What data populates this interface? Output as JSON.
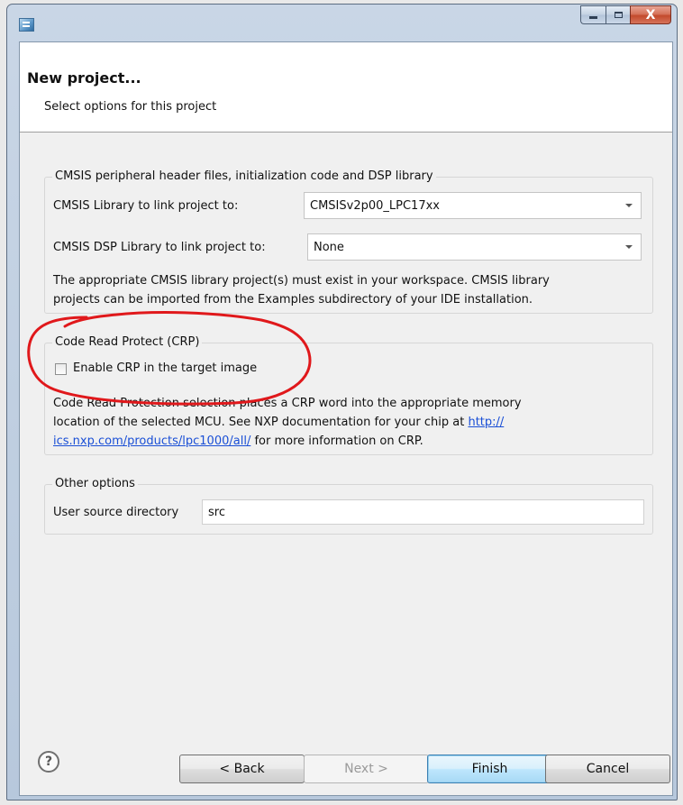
{
  "window": {
    "controls": {
      "minimize": "minimize",
      "maximize": "maximize",
      "close": "X"
    }
  },
  "header": {
    "title": "New project...",
    "subtitle": "Select options for this project"
  },
  "cmsis_group": {
    "legend": "CMSIS peripheral header files, initialization code and DSP library",
    "library_label": "CMSIS Library to link project to:",
    "library_value": "CMSISv2p00_LPC17xx",
    "dsp_label": "CMSIS DSP Library to link project to:",
    "dsp_value": "None",
    "note_line1": "The appropriate CMSIS library project(s) must exist in your workspace. CMSIS library",
    "note_line2": "projects can be imported from the Examples subdirectory of your IDE installation."
  },
  "crp_group": {
    "legend": "Code Read Protect (CRP)",
    "checkbox_label": "Enable CRP in the target image",
    "checkbox_checked": false,
    "desc_line1": "Code Read Protection selection places a CRP word into the appropriate memory",
    "desc_line2_text": "location of the selected MCU. See NXP documentation for your chip at ",
    "link_part1": "http://",
    "link_part2": "ics.nxp.com/products/lpc1000/all/",
    "desc_line3_text": " for more information on CRP."
  },
  "other_group": {
    "legend": "Other options",
    "source_dir_label": "User source directory",
    "source_dir_value": "src"
  },
  "buttons": {
    "help": "?",
    "back": "< Back",
    "next": "Next >",
    "finish": "Finish",
    "cancel": "Cancel"
  },
  "colors": {
    "annotation": "#e0181b",
    "link": "#1a4fd6",
    "default_button": "#3c7fb1"
  }
}
